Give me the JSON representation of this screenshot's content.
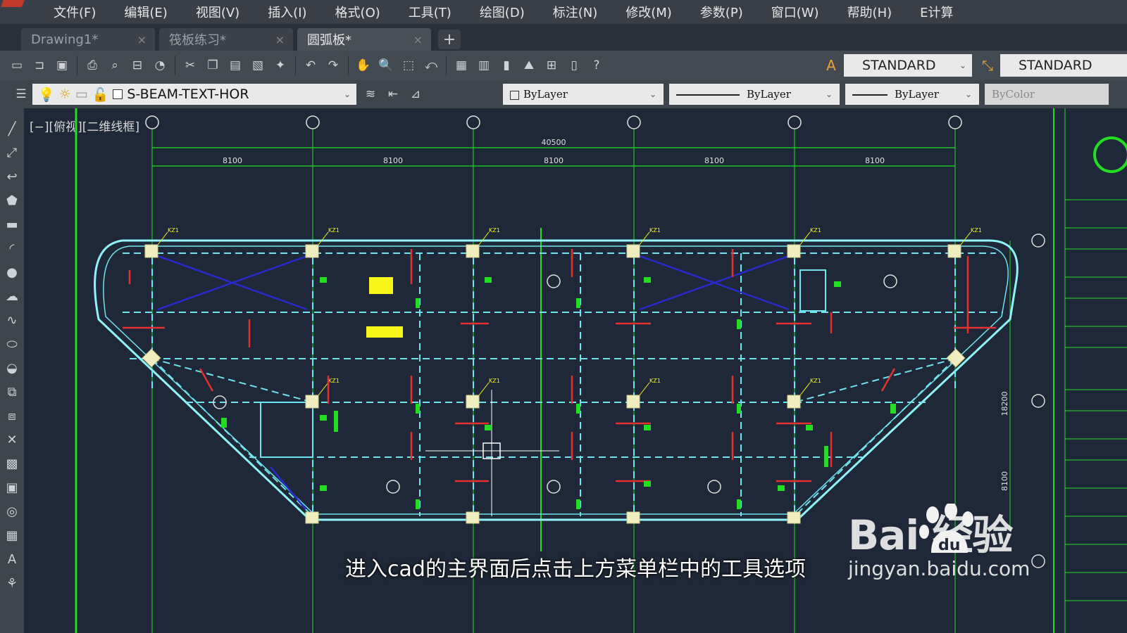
{
  "menu": [
    "文件(F)",
    "编辑(E)",
    "视图(V)",
    "插入(I)",
    "格式(O)",
    "工具(T)",
    "绘图(D)",
    "标注(N)",
    "修改(M)",
    "参数(P)",
    "窗口(W)",
    "帮助(H)",
    "E计算"
  ],
  "tabs": [
    {
      "label": "Drawing1*",
      "active": false
    },
    {
      "label": "筏板练习*",
      "active": false
    },
    {
      "label": "圆弧板*",
      "active": true
    }
  ],
  "tab_add": "+",
  "toolbar": {
    "text_style": "STANDARD",
    "dim_style": "STANDARD",
    "layer": "S-BEAM-TEXT-HOR",
    "color": "ByLayer",
    "linetype": "ByLayer",
    "lineweight": "ByLayer",
    "plotstyle": "ByColor"
  },
  "viewport_label": "[−][俯视][二维线框]",
  "drawing": {
    "dim_total": "40500",
    "spans": [
      "8100",
      "8100",
      "8100",
      "8100",
      "8100"
    ],
    "column_label": "KZ1",
    "right_dims": [
      "18200",
      "8100"
    ]
  },
  "subtitle": "进入cad的主界面后点击上方菜单栏中的工具选项",
  "watermark": {
    "brand": "Bai  经验",
    "url": "jingyan.baidu.com"
  },
  "colors": {
    "accent_green": "#22dd22",
    "wall_cyan": "#6fe3ee",
    "beam_red": "#e53030",
    "label_yellow": "#f5f51a"
  }
}
